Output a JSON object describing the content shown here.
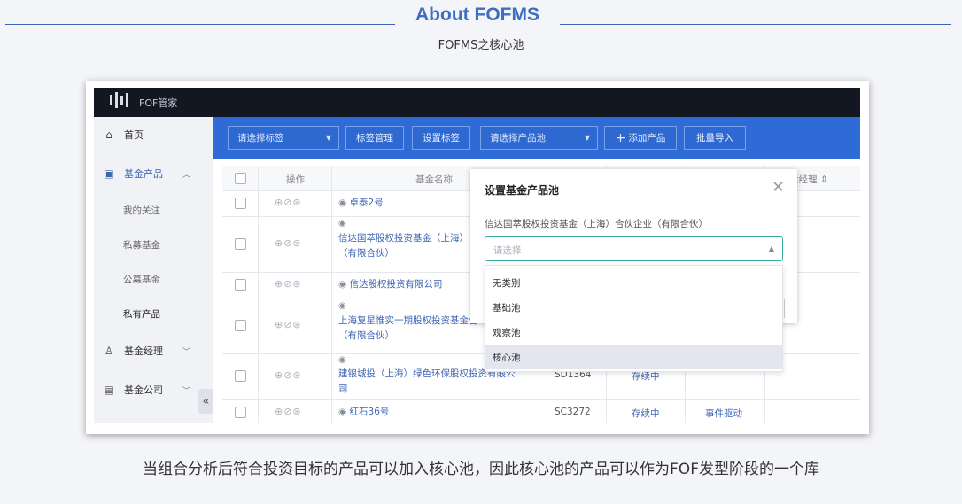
{
  "header": {
    "title": "About FOFMS",
    "subtitle": "FOFMS之核心池"
  },
  "app": {
    "logo_text": "FOF管家",
    "sidebar": {
      "items": [
        {
          "label": "首页",
          "icon": "home-icon"
        },
        {
          "label": "基金产品",
          "icon": "fund-product-icon"
        },
        {
          "label": "我的关注"
        },
        {
          "label": "私募基金"
        },
        {
          "label": "公募基金"
        },
        {
          "label": "私有产品"
        },
        {
          "label": "基金经理",
          "icon": "manager-icon"
        },
        {
          "label": "基金公司",
          "icon": "company-icon"
        }
      ],
      "collapse_glyph": "«"
    },
    "toolbar": {
      "tag_select_placeholder": "请选择标签",
      "tag_manage": "标签管理",
      "tag_set": "设置标签",
      "pool_select_placeholder": "请选择产品池",
      "add_product": "添加产品",
      "batch_import": "批量导入"
    },
    "table": {
      "headers": {
        "ops": "操作",
        "name": "基金名称",
        "manager": "金经理"
      },
      "rows": [
        {
          "name_lines": [
            "卓泰2号"
          ],
          "eye_inline": true
        },
        {
          "name_lines": [
            "信达国萃股权投资基金（上海）",
            "（有限合伙）"
          ],
          "eye_inline": false
        },
        {
          "name_lines": [
            "信达股权投资有限公司"
          ],
          "eye_inline": true
        },
        {
          "name_lines": [
            "上海复星惟实一期股权投资基金合",
            "（有限合伙）"
          ],
          "eye_inline": false
        },
        {
          "name_lines": [
            "建银城投（上海）绿色环保股权投资有限公",
            "司"
          ],
          "eye_inline": false,
          "code": "SD1364",
          "status": "存续中"
        },
        {
          "name_lines": [
            "红石36号"
          ],
          "eye_inline": true,
          "code": "SC3272",
          "status": "存续中",
          "strategy": "事件驱动"
        }
      ]
    },
    "modal": {
      "title": "设置基金产品池",
      "fund_name": "信达国萃股权投资基金（上海）合伙企业（有限合伙）",
      "select_placeholder": "请选择",
      "options": [
        "无类别",
        "基础池",
        "观察池",
        "核心池"
      ],
      "selected_option": "核心池"
    }
  },
  "caption": "当组合分析后符合投资目标的产品可以加入核心池，因此核心池的产品可以作为FOF发型阶段的一个库"
}
